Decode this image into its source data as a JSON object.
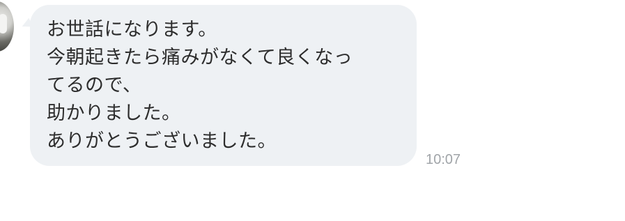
{
  "message": {
    "lines": [
      "お世話になります。",
      "今朝起きたら痛みがなくて良くなっ",
      "てるので、",
      "助かりました。",
      "ありがとうございました。"
    ],
    "time": "10:07"
  },
  "sender": {
    "avatar_icon": "avatar-photo"
  },
  "colors": {
    "bubble": "#eef1f4",
    "text": "#2d2d2d",
    "timestamp": "#a0a4a8"
  }
}
